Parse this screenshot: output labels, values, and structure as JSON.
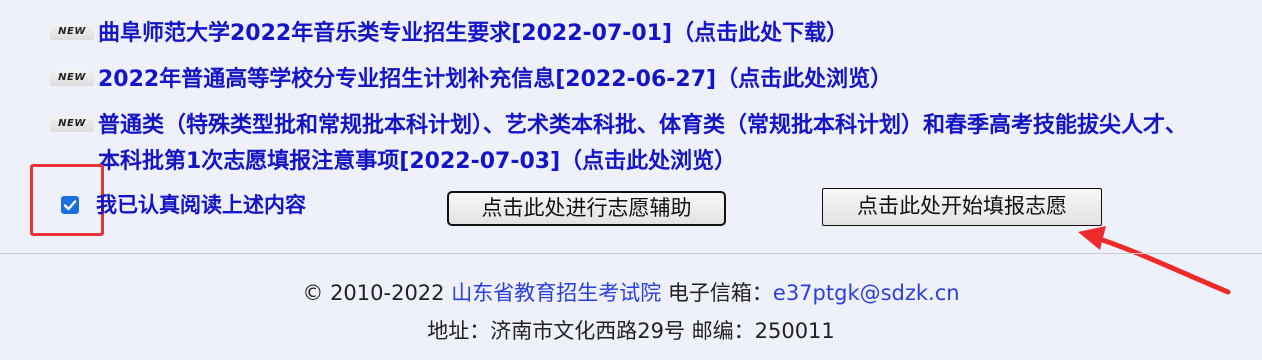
{
  "notices": [
    {
      "badge": "NEW",
      "text": "曲阜师范大学2022年音乐类专业招生要求[2022-07-01]（点击此处下载）"
    },
    {
      "badge": "NEW",
      "text": "2022年普通高等学校分专业招生计划补充信息[2022-06-27]（点击此处浏览）"
    },
    {
      "badge": "NEW",
      "text": "普通类（特殊类型批和常规批本科计划）、艺术类本科批、体育类（常规批本科计划）和春季高考技能拔尖人才、本科批第1次志愿填报注意事项[2022-07-03]（点击此处浏览）"
    }
  ],
  "agreement": {
    "checked": true,
    "label": "我已认真阅读上述内容"
  },
  "buttons": {
    "assist": "点击此处进行志愿辅助",
    "start": "点击此处开始填报志愿"
  },
  "footer": {
    "copyright": "© 2010-2022",
    "org_link": "山东省教育招生考试院",
    "email_label": "电子信箱：",
    "email": "e37ptgk@sdzk.cn",
    "address": "地址：济南市文化西路29号 邮编：250011"
  },
  "colors": {
    "link": "#1515c8",
    "highlight": "#e8323a",
    "background": "#eef0fa"
  }
}
